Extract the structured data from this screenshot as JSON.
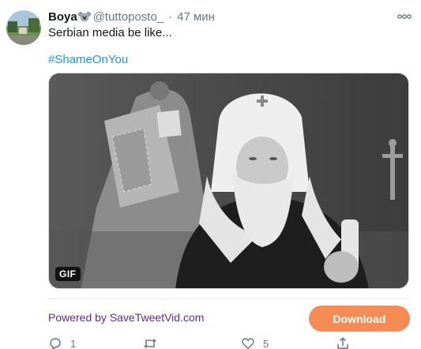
{
  "tweet": {
    "display_name": "Boya",
    "name_emoji": "koala-emoji",
    "handle": "@tuttoposto_",
    "separator": "·",
    "time": "47 мин",
    "text": "Serbian media be like...",
    "hashtag": "#ShameOnYou",
    "media_badge": "GIF"
  },
  "footer": {
    "powered_by": "Powered by SaveTweetVid.com",
    "download_label": "Download"
  },
  "actions": {
    "reply_count": "1",
    "retweet_count": "",
    "like_count": "5"
  },
  "colors": {
    "link": "#1b95e0",
    "powered_text": "#5b2d91",
    "download_button": "#f58b55",
    "muted": "#657786"
  }
}
